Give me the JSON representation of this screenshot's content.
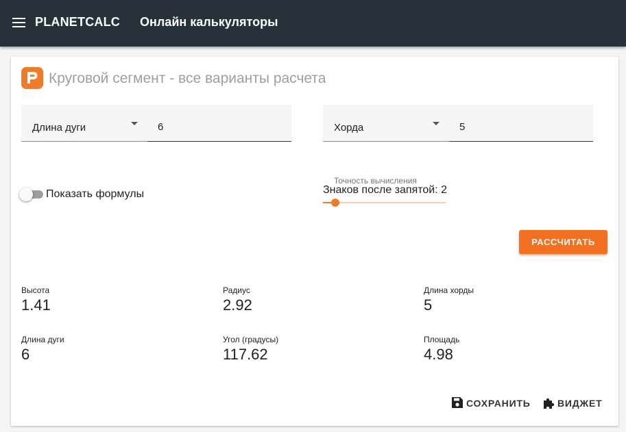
{
  "header": {
    "brand": "PLANETCALC",
    "title": "Онлайн калькуляторы"
  },
  "calculator": {
    "title": "Круговой сегмент - все варианты расчета",
    "inputs": [
      {
        "select_label": "Длина дуги",
        "value": "6"
      },
      {
        "select_label": "Хорда",
        "value": "5"
      }
    ],
    "show_formulas_label": "Показать формулы",
    "show_formulas_on": false,
    "precision": {
      "caption": "Точность вычисления",
      "value_label": "Знаков после запятой: 2",
      "value": 2,
      "fraction": 0.1
    },
    "calculate_label": "РАССЧИТАТЬ"
  },
  "results": [
    {
      "label": "Высота",
      "value": "1.41"
    },
    {
      "label": "Радиус",
      "value": "2.92"
    },
    {
      "label": "Длина хорды",
      "value": "5"
    },
    {
      "label": "Длина дуги",
      "value": "6"
    },
    {
      "label": "Угол (градусы)",
      "value": "117.62"
    },
    {
      "label": "Площадь",
      "value": "4.98"
    }
  ],
  "actions": {
    "save_label": "СОХРАНИТЬ",
    "widget_label": "ВИДЖЕТ"
  },
  "icons": {
    "menu": "menu-icon",
    "logo": "planetcalc-logo-icon",
    "save": "floppy-disk-icon",
    "widget": "puzzle-piece-icon"
  },
  "colors": {
    "topbar": "#283039",
    "accent": "#f07c28",
    "button": "#f37021"
  }
}
